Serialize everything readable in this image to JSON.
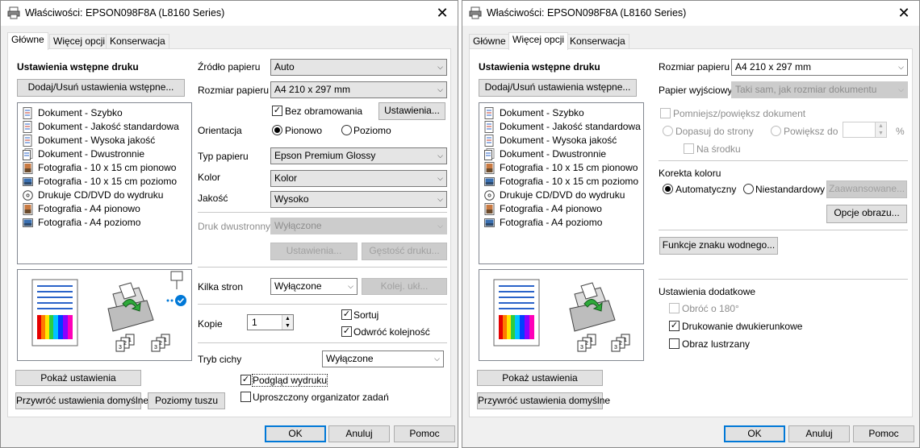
{
  "window_title": "Właściwości: EPSON098F8A (L8160 Series)",
  "close_glyph": "✕",
  "tabs": [
    "Główne",
    "Więcej opcji",
    "Konserwacja"
  ],
  "footer": {
    "ok": "OK",
    "cancel": "Anuluj",
    "help": "Pomoc"
  },
  "main": {
    "presets_title": "Ustawienia wstępne druku",
    "add_remove_button": "Dodaj/Usuń ustawienia wstępne...",
    "presets": [
      {
        "label": "Dokument - Szybko",
        "icon": "document-icon"
      },
      {
        "label": "Dokument - Jakość standardowa",
        "icon": "document-icon"
      },
      {
        "label": "Dokument - Wysoka jakość",
        "icon": "document-icon"
      },
      {
        "label": "Dokument - Dwustronnie",
        "icon": "duplex-document-icon"
      },
      {
        "label": "Fotografia - 10 x 15 cm pionowo",
        "icon": "photo-portrait-icon"
      },
      {
        "label": "Fotografia - 10 x 15 cm poziomo",
        "icon": "photo-landscape-icon"
      },
      {
        "label": "Drukuje CD/DVD do wydruku",
        "icon": "cd-icon"
      },
      {
        "label": "Fotografia - A4 pionowo",
        "icon": "photo-portrait-icon"
      },
      {
        "label": "Fotografia - A4 poziomo",
        "icon": "photo-landscape-icon"
      }
    ],
    "paper_source_label": "Źródło papieru",
    "paper_source_value": "Auto",
    "paper_size_label": "Rozmiar papieru",
    "paper_size_value": "A4 210 x 297 mm",
    "borderless_label": "Bez obramowania",
    "borderless_checked": true,
    "settings_button": "Ustawienia...",
    "orientation_label": "Orientacja",
    "portrait_label": "Pionowo",
    "landscape_label": "Poziomo",
    "orientation_selected": "Pionowo",
    "paper_type_label": "Typ papieru",
    "paper_type_value": "Epson Premium Glossy",
    "color_label": "Kolor",
    "color_value": "Kolor",
    "quality_label": "Jakość",
    "quality_value": "Wysoko",
    "duplex_label": "Druk dwustronny",
    "duplex_value": "Wyłączone",
    "duplex_settings_button": "Ustawienia...",
    "density_button": "Gęstość druku...",
    "multipage_label": "Kilka stron",
    "multipage_value": "Wyłączone",
    "page_order_button": "Kolej. ukł...",
    "copies_label": "Kopie",
    "copies_value": "1",
    "collate_label": "Sortuj",
    "collate_checked": true,
    "reverse_label": "Odwróć kolejność",
    "reverse_checked": true,
    "quiet_label": "Tryb cichy",
    "quiet_value": "Wyłączone",
    "show_settings_button": "Pokaż ustawienia",
    "restore_defaults_button": "Przywróć ustawienia domyślne",
    "ink_levels_button": "Poziomy tuszu",
    "print_preview_label": "Podgląd wydruku",
    "print_preview_checked": true,
    "job_arranger_label": "Uproszczony organizator zadań",
    "job_arranger_checked": false
  },
  "more": {
    "paper_size_label": "Rozmiar papieru",
    "paper_size_value": "A4 210 x 297 mm",
    "output_paper_label": "Papier wyjściowy",
    "output_paper_value": "Taki sam, jak rozmiar dokumentu",
    "reduce_enlarge_label": "Pomniejsz/powiększ dokument",
    "fit_to_page_label": "Dopasuj do strony",
    "zoom_to_label": "Powiększ do",
    "percent_sign": "%",
    "center_label": "Na środku",
    "color_correction_label": "Korekta koloru",
    "automatic_label": "Automatyczny",
    "custom_label": "Niestandardowy",
    "color_correction_selected": "Automatyczny",
    "advanced_button": "Zaawansowane...",
    "image_options_button": "Opcje obrazu...",
    "watermark_button": "Funkcje znaku wodnego...",
    "extra_settings_label": "Ustawienia dodatkowe",
    "rotate_label": "Obróć o 180°",
    "rotate_checked": false,
    "bidirectional_label": "Drukowanie dwukierunkowe",
    "bidirectional_checked": true,
    "mirror_label": "Obraz lustrzany",
    "mirror_checked": false,
    "show_settings_button": "Pokaż ustawienia",
    "restore_defaults_button": "Przywróć ustawienia domyślne"
  },
  "colors": {
    "accent": "#0078d7",
    "title_bg": "#ffffff",
    "dialog_bg": "#f0f0f0"
  }
}
